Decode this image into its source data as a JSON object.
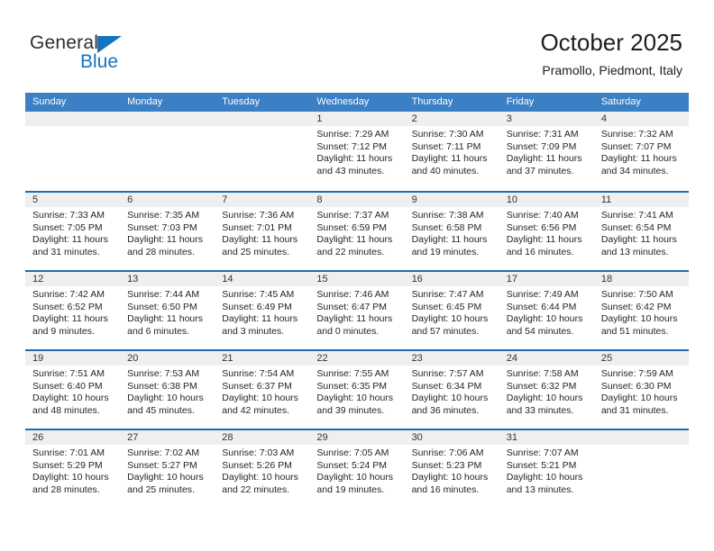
{
  "brand": {
    "name_top": "General",
    "name_bottom": "Blue",
    "accent_color": "#1573bd",
    "triangle_icon": "triangle-icon"
  },
  "header": {
    "title": "October 2025",
    "subtitle": "Pramollo, Piedmont, Italy"
  },
  "calendar": {
    "header_bg": "#3b7fc4",
    "header_text_color": "#ffffff",
    "row_divider_color": "#1f6cb0",
    "day_band_bg": "#efefef",
    "weekdays": [
      "Sunday",
      "Monday",
      "Tuesday",
      "Wednesday",
      "Thursday",
      "Friday",
      "Saturday"
    ],
    "weeks": [
      [
        {
          "day": "",
          "empty": true,
          "sunrise": "",
          "sunset": "",
          "daylight_1": "",
          "daylight_2": ""
        },
        {
          "day": "",
          "empty": true,
          "sunrise": "",
          "sunset": "",
          "daylight_1": "",
          "daylight_2": ""
        },
        {
          "day": "",
          "empty": true,
          "sunrise": "",
          "sunset": "",
          "daylight_1": "",
          "daylight_2": ""
        },
        {
          "day": "1",
          "sunrise": "Sunrise: 7:29 AM",
          "sunset": "Sunset: 7:12 PM",
          "daylight_1": "Daylight: 11 hours",
          "daylight_2": "and 43 minutes."
        },
        {
          "day": "2",
          "sunrise": "Sunrise: 7:30 AM",
          "sunset": "Sunset: 7:11 PM",
          "daylight_1": "Daylight: 11 hours",
          "daylight_2": "and 40 minutes."
        },
        {
          "day": "3",
          "sunrise": "Sunrise: 7:31 AM",
          "sunset": "Sunset: 7:09 PM",
          "daylight_1": "Daylight: 11 hours",
          "daylight_2": "and 37 minutes."
        },
        {
          "day": "4",
          "sunrise": "Sunrise: 7:32 AM",
          "sunset": "Sunset: 7:07 PM",
          "daylight_1": "Daylight: 11 hours",
          "daylight_2": "and 34 minutes."
        }
      ],
      [
        {
          "day": "5",
          "sunrise": "Sunrise: 7:33 AM",
          "sunset": "Sunset: 7:05 PM",
          "daylight_1": "Daylight: 11 hours",
          "daylight_2": "and 31 minutes."
        },
        {
          "day": "6",
          "sunrise": "Sunrise: 7:35 AM",
          "sunset": "Sunset: 7:03 PM",
          "daylight_1": "Daylight: 11 hours",
          "daylight_2": "and 28 minutes."
        },
        {
          "day": "7",
          "sunrise": "Sunrise: 7:36 AM",
          "sunset": "Sunset: 7:01 PM",
          "daylight_1": "Daylight: 11 hours",
          "daylight_2": "and 25 minutes."
        },
        {
          "day": "8",
          "sunrise": "Sunrise: 7:37 AM",
          "sunset": "Sunset: 6:59 PM",
          "daylight_1": "Daylight: 11 hours",
          "daylight_2": "and 22 minutes."
        },
        {
          "day": "9",
          "sunrise": "Sunrise: 7:38 AM",
          "sunset": "Sunset: 6:58 PM",
          "daylight_1": "Daylight: 11 hours",
          "daylight_2": "and 19 minutes."
        },
        {
          "day": "10",
          "sunrise": "Sunrise: 7:40 AM",
          "sunset": "Sunset: 6:56 PM",
          "daylight_1": "Daylight: 11 hours",
          "daylight_2": "and 16 minutes."
        },
        {
          "day": "11",
          "sunrise": "Sunrise: 7:41 AM",
          "sunset": "Sunset: 6:54 PM",
          "daylight_1": "Daylight: 11 hours",
          "daylight_2": "and 13 minutes."
        }
      ],
      [
        {
          "day": "12",
          "sunrise": "Sunrise: 7:42 AM",
          "sunset": "Sunset: 6:52 PM",
          "daylight_1": "Daylight: 11 hours",
          "daylight_2": "and 9 minutes."
        },
        {
          "day": "13",
          "sunrise": "Sunrise: 7:44 AM",
          "sunset": "Sunset: 6:50 PM",
          "daylight_1": "Daylight: 11 hours",
          "daylight_2": "and 6 minutes."
        },
        {
          "day": "14",
          "sunrise": "Sunrise: 7:45 AM",
          "sunset": "Sunset: 6:49 PM",
          "daylight_1": "Daylight: 11 hours",
          "daylight_2": "and 3 minutes."
        },
        {
          "day": "15",
          "sunrise": "Sunrise: 7:46 AM",
          "sunset": "Sunset: 6:47 PM",
          "daylight_1": "Daylight: 11 hours",
          "daylight_2": "and 0 minutes."
        },
        {
          "day": "16",
          "sunrise": "Sunrise: 7:47 AM",
          "sunset": "Sunset: 6:45 PM",
          "daylight_1": "Daylight: 10 hours",
          "daylight_2": "and 57 minutes."
        },
        {
          "day": "17",
          "sunrise": "Sunrise: 7:49 AM",
          "sunset": "Sunset: 6:44 PM",
          "daylight_1": "Daylight: 10 hours",
          "daylight_2": "and 54 minutes."
        },
        {
          "day": "18",
          "sunrise": "Sunrise: 7:50 AM",
          "sunset": "Sunset: 6:42 PM",
          "daylight_1": "Daylight: 10 hours",
          "daylight_2": "and 51 minutes."
        }
      ],
      [
        {
          "day": "19",
          "sunrise": "Sunrise: 7:51 AM",
          "sunset": "Sunset: 6:40 PM",
          "daylight_1": "Daylight: 10 hours",
          "daylight_2": "and 48 minutes."
        },
        {
          "day": "20",
          "sunrise": "Sunrise: 7:53 AM",
          "sunset": "Sunset: 6:38 PM",
          "daylight_1": "Daylight: 10 hours",
          "daylight_2": "and 45 minutes."
        },
        {
          "day": "21",
          "sunrise": "Sunrise: 7:54 AM",
          "sunset": "Sunset: 6:37 PM",
          "daylight_1": "Daylight: 10 hours",
          "daylight_2": "and 42 minutes."
        },
        {
          "day": "22",
          "sunrise": "Sunrise: 7:55 AM",
          "sunset": "Sunset: 6:35 PM",
          "daylight_1": "Daylight: 10 hours",
          "daylight_2": "and 39 minutes."
        },
        {
          "day": "23",
          "sunrise": "Sunrise: 7:57 AM",
          "sunset": "Sunset: 6:34 PM",
          "daylight_1": "Daylight: 10 hours",
          "daylight_2": "and 36 minutes."
        },
        {
          "day": "24",
          "sunrise": "Sunrise: 7:58 AM",
          "sunset": "Sunset: 6:32 PM",
          "daylight_1": "Daylight: 10 hours",
          "daylight_2": "and 33 minutes."
        },
        {
          "day": "25",
          "sunrise": "Sunrise: 7:59 AM",
          "sunset": "Sunset: 6:30 PM",
          "daylight_1": "Daylight: 10 hours",
          "daylight_2": "and 31 minutes."
        }
      ],
      [
        {
          "day": "26",
          "sunrise": "Sunrise: 7:01 AM",
          "sunset": "Sunset: 5:29 PM",
          "daylight_1": "Daylight: 10 hours",
          "daylight_2": "and 28 minutes."
        },
        {
          "day": "27",
          "sunrise": "Sunrise: 7:02 AM",
          "sunset": "Sunset: 5:27 PM",
          "daylight_1": "Daylight: 10 hours",
          "daylight_2": "and 25 minutes."
        },
        {
          "day": "28",
          "sunrise": "Sunrise: 7:03 AM",
          "sunset": "Sunset: 5:26 PM",
          "daylight_1": "Daylight: 10 hours",
          "daylight_2": "and 22 minutes."
        },
        {
          "day": "29",
          "sunrise": "Sunrise: 7:05 AM",
          "sunset": "Sunset: 5:24 PM",
          "daylight_1": "Daylight: 10 hours",
          "daylight_2": "and 19 minutes."
        },
        {
          "day": "30",
          "sunrise": "Sunrise: 7:06 AM",
          "sunset": "Sunset: 5:23 PM",
          "daylight_1": "Daylight: 10 hours",
          "daylight_2": "and 16 minutes."
        },
        {
          "day": "31",
          "sunrise": "Sunrise: 7:07 AM",
          "sunset": "Sunset: 5:21 PM",
          "daylight_1": "Daylight: 10 hours",
          "daylight_2": "and 13 minutes."
        },
        {
          "day": "",
          "empty": true,
          "sunrise": "",
          "sunset": "",
          "daylight_1": "",
          "daylight_2": ""
        }
      ]
    ]
  }
}
